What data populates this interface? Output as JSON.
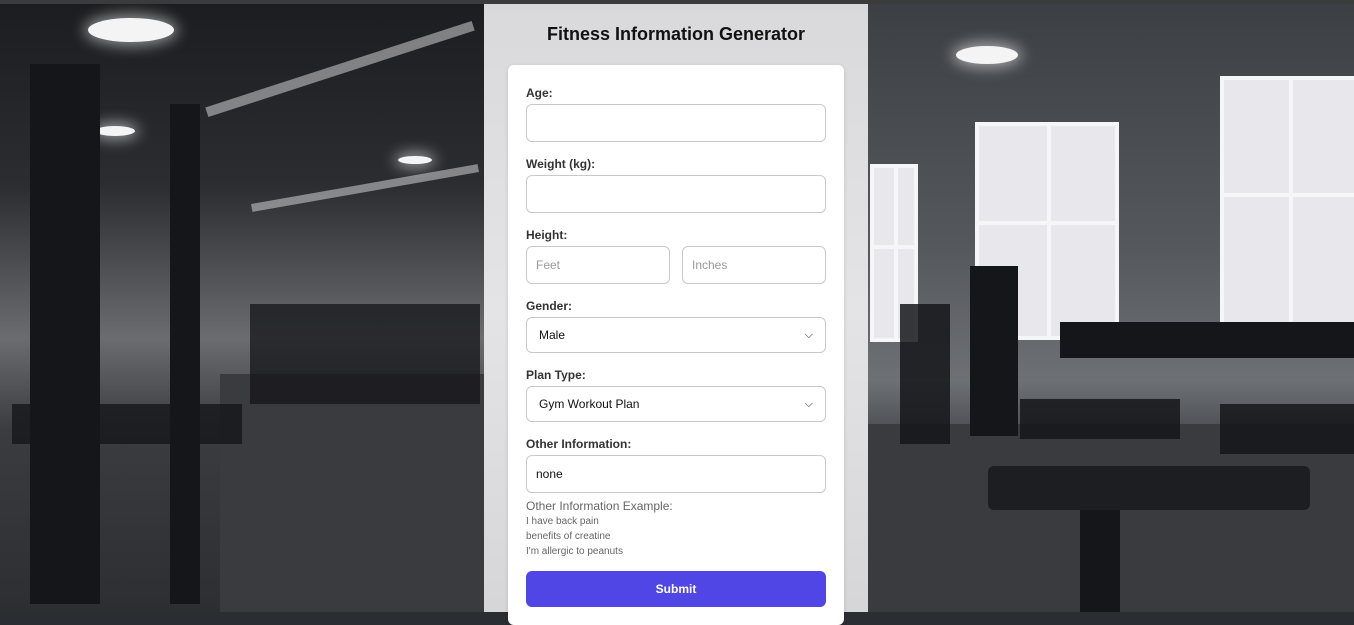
{
  "page": {
    "title": "Fitness Information Generator"
  },
  "form": {
    "age": {
      "label": "Age:",
      "value": ""
    },
    "weight": {
      "label": "Weight (kg):",
      "value": ""
    },
    "height": {
      "label": "Height:",
      "feet_placeholder": "Feet",
      "inches_placeholder": "Inches"
    },
    "gender": {
      "label": "Gender:",
      "selected": "Male"
    },
    "plan_type": {
      "label": "Plan Type:",
      "selected": "Gym Workout Plan"
    },
    "other_info": {
      "label": "Other Information:",
      "value": "none",
      "example_title": "Other Information Example:",
      "examples": [
        "I have back pain",
        "benefits of creatine",
        "I'm allergic to peanuts"
      ]
    },
    "submit_label": "Submit"
  },
  "icons": {
    "dropdown": "chevron-down-icon"
  },
  "colors": {
    "accent": "#4f46e5",
    "card_bg": "#ffffff",
    "text": "#111111"
  }
}
